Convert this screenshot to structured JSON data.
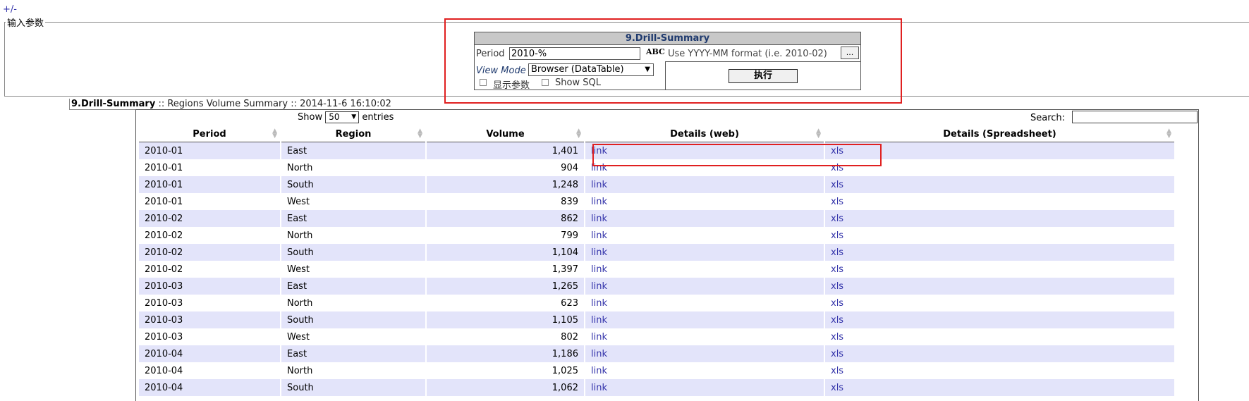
{
  "toggle_label": "+/-",
  "params_legend": "输入参数",
  "form": {
    "title": "9.Drill-Summary",
    "period_label": "Period",
    "period_value": "2010-%",
    "abc_icon": "ABC",
    "hint": "Use YYYY-MM format (i.e. 2010-02)",
    "dots_label": "...",
    "viewmode_label": "View Mode",
    "viewmode_value": "Browser (DataTable)",
    "show_params_label": "显示参数",
    "show_sql_label": "Show SQL",
    "exec_label": "执行"
  },
  "summary": {
    "report_name": "9.Drill-Summary",
    "rest": " :: Regions Volume Summary :: 2014-11-6 16:10:02"
  },
  "table_controls": {
    "show_label": "Show",
    "length_value": "50",
    "entries_label": "entries",
    "search_label": "Search:"
  },
  "table": {
    "headers": [
      "Period",
      "Region",
      "Volume",
      "Details (web)",
      "Details (Spreadsheet)"
    ],
    "rows": [
      [
        "2010-01",
        "East",
        "1,401",
        "link",
        "xls"
      ],
      [
        "2010-01",
        "North",
        "904",
        "link",
        "xls"
      ],
      [
        "2010-01",
        "South",
        "1,248",
        "link",
        "xls"
      ],
      [
        "2010-01",
        "West",
        "839",
        "link",
        "xls"
      ],
      [
        "2010-02",
        "East",
        "862",
        "link",
        "xls"
      ],
      [
        "2010-02",
        "North",
        "799",
        "link",
        "xls"
      ],
      [
        "2010-02",
        "South",
        "1,104",
        "link",
        "xls"
      ],
      [
        "2010-02",
        "West",
        "1,397",
        "link",
        "xls"
      ],
      [
        "2010-03",
        "East",
        "1,265",
        "link",
        "xls"
      ],
      [
        "2010-03",
        "North",
        "623",
        "link",
        "xls"
      ],
      [
        "2010-03",
        "South",
        "1,105",
        "link",
        "xls"
      ],
      [
        "2010-03",
        "West",
        "802",
        "link",
        "xls"
      ],
      [
        "2010-04",
        "East",
        "1,186",
        "link",
        "xls"
      ],
      [
        "2010-04",
        "North",
        "1,025",
        "link",
        "xls"
      ],
      [
        "2010-04",
        "South",
        "1,062",
        "link",
        "xls"
      ]
    ]
  },
  "colors": {
    "odd_row": "#e3e4fa",
    "link": "#3333aa",
    "highlight_box": "#e02020",
    "form_title_bg": "#c8c8c8"
  }
}
